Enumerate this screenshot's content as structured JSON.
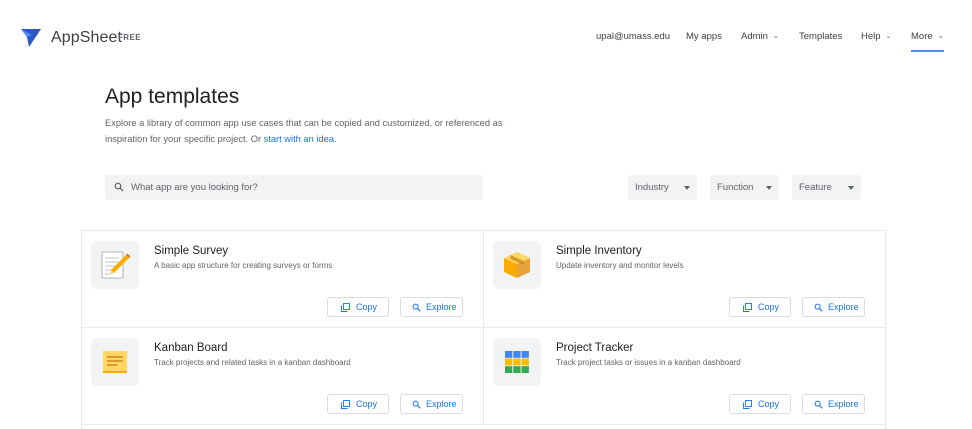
{
  "header": {
    "brand": "AppSheet",
    "brand_tag": "FREE",
    "nav": {
      "email": "upal@umass.edu",
      "my_apps": "My apps",
      "admin": "Admin",
      "templates": "Templates",
      "help": "Help",
      "more": "More"
    },
    "accent_color": "#4c8df6"
  },
  "intro": {
    "title": "App templates",
    "description": "Explore a library of common app use cases that can be copied and customized, or referenced as inspiration for your specific project. Or ",
    "link_text": "start with an idea.",
    "link_color": "#1a73e8"
  },
  "search": {
    "placeholder": "What app are you looking for?",
    "value": ""
  },
  "filters": {
    "industry": "Industry",
    "function": "Function",
    "feature": "Feature"
  },
  "templates": [
    {
      "title": "Simple Survey",
      "description": "A basic app structure for creating surveys or forms",
      "icon": "notepad-pencil-icon",
      "copy_label": "Copy",
      "explore_label": "Explore"
    },
    {
      "title": "Simple Inventory",
      "description": "Update inventory and monitor levels",
      "icon": "box-icon",
      "copy_label": "Copy",
      "explore_label": "Explore"
    },
    {
      "title": "Kanban Board",
      "description": "Track projects and related tasks in a kanban dashboard",
      "icon": "sticky-note-icon",
      "copy_label": "Copy",
      "explore_label": "Explore"
    },
    {
      "title": "Project Tracker",
      "description": "Track project tasks or issues in a kanban dashboard",
      "icon": "color-grid-icon",
      "copy_label": "Copy",
      "explore_label": "Explore"
    }
  ]
}
